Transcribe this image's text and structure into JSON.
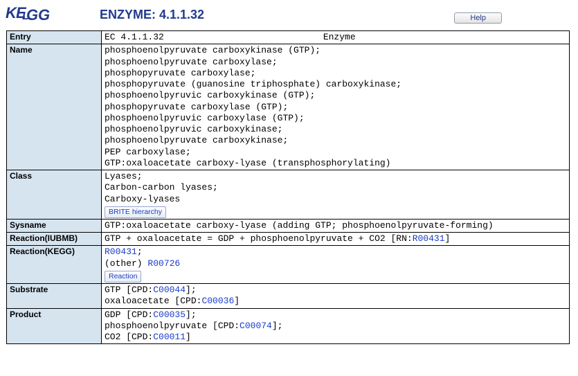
{
  "header": {
    "logo_text": "KEGG",
    "title": "ENZYME: 4.1.1.32",
    "help_label": "Help"
  },
  "entry": {
    "label": "Entry",
    "ec": "EC  4.1.1.32",
    "type": "Enzyme"
  },
  "name": {
    "label": "Name",
    "lines": [
      "phosphoenolpyruvate carboxykinase (GTP);",
      "phosphoenolpyruvate carboxylase;",
      "phosphopyruvate carboxylase;",
      "phosphopyruvate (guanosine triphosphate) carboxykinase;",
      "phosphoenolpyruvic carboxykinase (GTP);",
      "phosphopyruvate carboxylase (GTP);",
      "phosphoenolpyruvic carboxylase (GTP);",
      "phosphoenolpyruvic carboxykinase;",
      "phosphoenolpyruvate carboxykinase;",
      "PEP carboxylase;",
      "GTP:oxaloacetate carboxy-lyase (transphosphorylating)"
    ]
  },
  "class": {
    "label": "Class",
    "lines": [
      "Lyases;",
      "Carbon-carbon lyases;",
      "Carboxy-lyases"
    ],
    "button": "BRITE hierarchy"
  },
  "sysname": {
    "label": "Sysname",
    "value": "GTP:oxaloacetate carboxy-lyase (adding GTP; phosphoenolpyruvate-forming)"
  },
  "reaction_iubmb": {
    "label": "Reaction(IUBMB)",
    "prefix": "GTP + oxaloacetate = GDP + phosphoenolpyruvate + CO2 [RN:",
    "rn": "R00431",
    "suffix": "]"
  },
  "reaction_kegg": {
    "label": "Reaction(KEGG)",
    "r1": "R00431",
    "sep": ";",
    "other_label": "(other) ",
    "r2": "R00726",
    "button": "Reaction"
  },
  "substrate": {
    "label": "Substrate",
    "items": [
      {
        "pre": "GTP [CPD:",
        "cpd": "C00044",
        "post": "];"
      },
      {
        "pre": "oxaloacetate [CPD:",
        "cpd": "C00036",
        "post": "]"
      }
    ]
  },
  "product": {
    "label": "Product",
    "items": [
      {
        "pre": "GDP [CPD:",
        "cpd": "C00035",
        "post": "];"
      },
      {
        "pre": "phosphoenolpyruvate [CPD:",
        "cpd": "C00074",
        "post": "];"
      },
      {
        "pre": "CO2 [CPD:",
        "cpd": "C00011",
        "post": "]"
      }
    ]
  }
}
